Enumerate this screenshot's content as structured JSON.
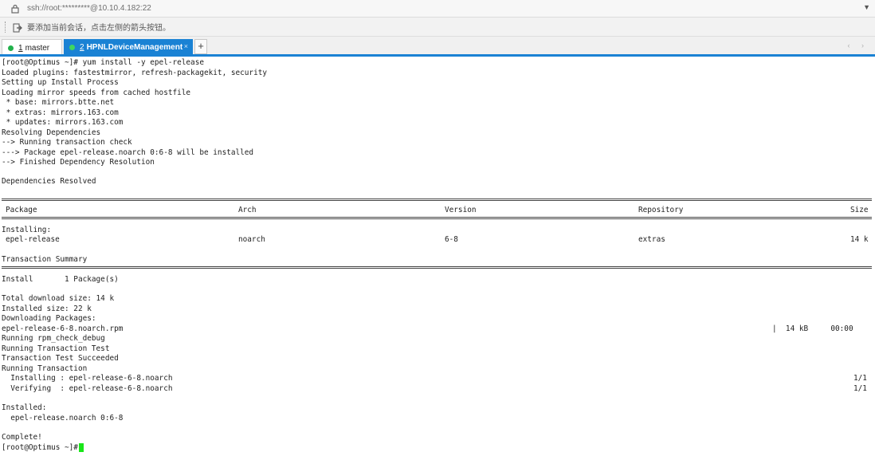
{
  "address_bar": {
    "url": "ssh://root:*********@10.10.4.182:22"
  },
  "hint_bar": {
    "text": "要添加当前会话，点击左侧的箭头按钮。"
  },
  "tabs": [
    {
      "number": "1",
      "title": "master",
      "active": false
    },
    {
      "number": "2",
      "title": "HPNLDeviceManagement",
      "active": true
    }
  ],
  "tab_controls": {
    "add": "+",
    "close": "×",
    "nav": "‹ ›"
  },
  "colors": {
    "accent": "#1a82d4",
    "session_dot": "#22b14c",
    "cursor": "#19e619"
  },
  "terminal": {
    "header_lines": [
      "[root@Optimus ~]# yum install -y epel-release",
      "Loaded plugins: fastestmirror, refresh-packagekit, security",
      "Setting up Install Process",
      "Loading mirror speeds from cached hostfile",
      " * base: mirrors.btte.net",
      " * extras: mirrors.163.com",
      " * updates: mirrors.163.com",
      "Resolving Dependencies",
      "--> Running transaction check",
      "---> Package epel-release.noarch 0:6-8 will be installed",
      "--> Finished Dependency Resolution",
      "",
      "Dependencies Resolved"
    ],
    "table": {
      "headers": {
        "package": "Package",
        "arch": "Arch",
        "version": "Version",
        "repository": "Repository",
        "size": "Size"
      },
      "section": "Installing:",
      "row": {
        "package": "epel-release",
        "arch": "noarch",
        "version": "6-8",
        "repository": "extras",
        "size": "14 k"
      }
    },
    "summary": {
      "title": "Transaction Summary",
      "install_line": "Install       1 Package(s)"
    },
    "download_lines": [
      "Total download size: 14 k",
      "Installed size: 22 k",
      "Downloading Packages:"
    ],
    "download_file": {
      "name": "epel-release-6-8.noarch.rpm",
      "progress": "|  14 kB     00:00"
    },
    "run_lines": [
      "Running rpm_check_debug",
      "Running Transaction Test",
      "Transaction Test Succeeded",
      "Running Transaction"
    ],
    "steps": [
      {
        "text": "  Installing : epel-release-6-8.noarch",
        "count": "1/1"
      },
      {
        "text": "  Verifying  : epel-release-6-8.noarch",
        "count": "1/1"
      }
    ],
    "installed_header": "Installed:",
    "installed_pkg": "  epel-release.noarch 0:6-8",
    "complete": "Complete!",
    "prompt": "[root@Optimus ~]# "
  }
}
